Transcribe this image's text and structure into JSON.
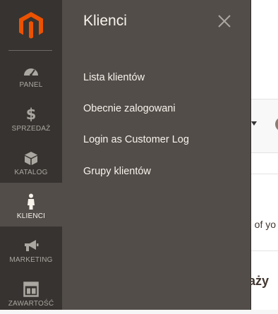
{
  "menu": {
    "items": [
      {
        "label": "PANEL",
        "icon": "dashboard-icon"
      },
      {
        "label": "SPRZEDAŻ",
        "icon": "dollar-icon"
      },
      {
        "label": "KATALOG",
        "icon": "box-icon"
      },
      {
        "label": "KLIENCI",
        "icon": "person-icon",
        "active": true
      },
      {
        "label": "MARKETING",
        "icon": "megaphone-icon"
      },
      {
        "label": "ZAWARTOŚĆ",
        "icon": "layout-icon"
      }
    ]
  },
  "flyout": {
    "title": "Klienci",
    "links": [
      "Lista klientów",
      "Obecnie zalogowani",
      "Login as Customer Log",
      "Grupy klientów"
    ]
  },
  "background": {
    "text_partial_1": "d of yo",
    "text_partial_2": "aży"
  },
  "colors": {
    "menu_bg": "#373330",
    "flyout_bg": "#524d49",
    "logo_orange": "#eb5202",
    "text_light": "#f7f3eb",
    "text_muted": "#aaa6a0"
  }
}
